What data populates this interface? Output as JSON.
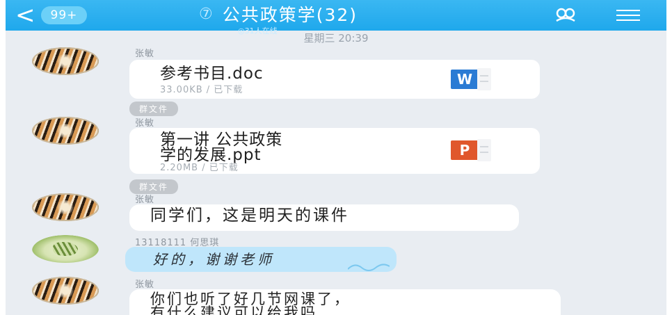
{
  "header": {
    "back_arrow": "<",
    "unread_badge": "99+",
    "group_icon": "⑦",
    "title": "公共政策学(32)",
    "online_status": "◎31人在线",
    "group_members_icon": "group-members-icon",
    "menu_icon": "menu-icon"
  },
  "timestamp": "星期三 20:39",
  "messages": [
    {
      "sender": "张敏",
      "kind": "file",
      "file_name": "参考书目.doc",
      "file_meta": "33.00KB / 已下载",
      "file_type": "W",
      "file_color": "#2a7bd4"
    },
    {
      "tag": "群文件"
    },
    {
      "sender": "张敏",
      "kind": "file",
      "file_name": "第一讲 公共政策\n学的发展.ppt",
      "file_meta": "2.20MB / 已下载",
      "file_type": "P",
      "file_color": "#e0572c"
    },
    {
      "tag": "群文件"
    },
    {
      "sender": "张敏",
      "kind": "text",
      "text": "同学们，这是明天的课件"
    },
    {
      "sender": "13118111 何思琪",
      "kind": "text",
      "text": "好的，谢谢老师"
    },
    {
      "sender": "张敏",
      "kind": "text",
      "text": "你们也听了好几节网课了，\n有什么建议可以给我吗"
    }
  ],
  "colors": {
    "header_bg": "#1fa8ec",
    "chat_bg": "#e9edf2",
    "bubble": "#ffffff",
    "bubble_blue": "#bfe6fb"
  }
}
